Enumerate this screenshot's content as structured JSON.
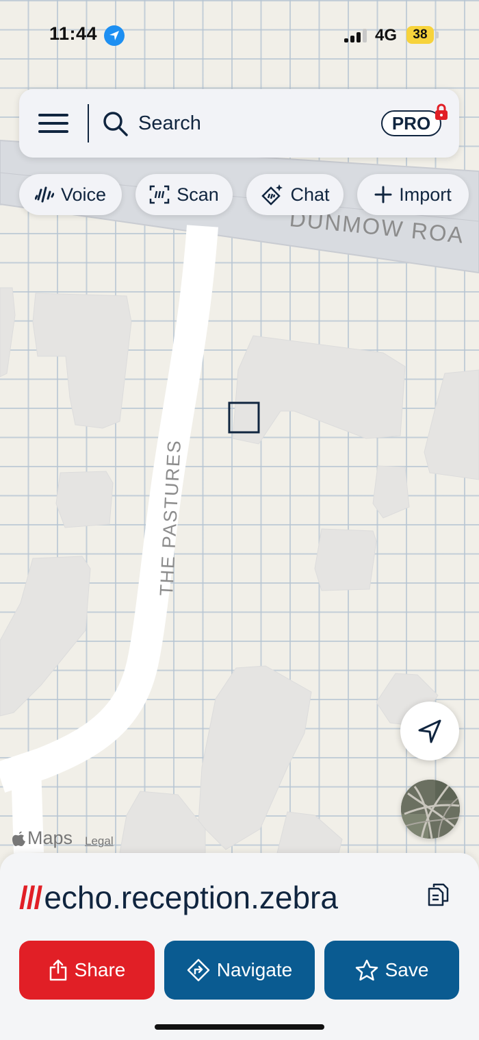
{
  "status_bar": {
    "time": "11:44",
    "network": "4G",
    "battery": "38"
  },
  "search": {
    "placeholder": "Search",
    "pro_label": "PRO"
  },
  "chips": [
    {
      "label": "Voice",
      "icon": "voice-icon"
    },
    {
      "label": "Scan",
      "icon": "scan-icon"
    },
    {
      "label": "Chat",
      "icon": "chat-icon"
    },
    {
      "label": "Import",
      "icon": "plus-icon"
    }
  ],
  "map": {
    "road_top": "DUNMOW ROA",
    "road_vertical": "THE PASTURES",
    "attribution": "Maps",
    "legal": "Legal"
  },
  "sheet": {
    "address_prefix": "///",
    "address": "echo.reception.zebra",
    "buttons": [
      {
        "label": "Share",
        "icon": "share-icon",
        "color": "#e11f26"
      },
      {
        "label": "Navigate",
        "icon": "navigate-icon",
        "color": "#0a5b91"
      },
      {
        "label": "Save",
        "icon": "star-icon",
        "color": "#0a5b91"
      }
    ]
  },
  "colors": {
    "brand_red": "#e11f26",
    "brand_blue": "#0a5b91",
    "text_dark": "#10253f",
    "map_bg": "#f1efe8"
  }
}
